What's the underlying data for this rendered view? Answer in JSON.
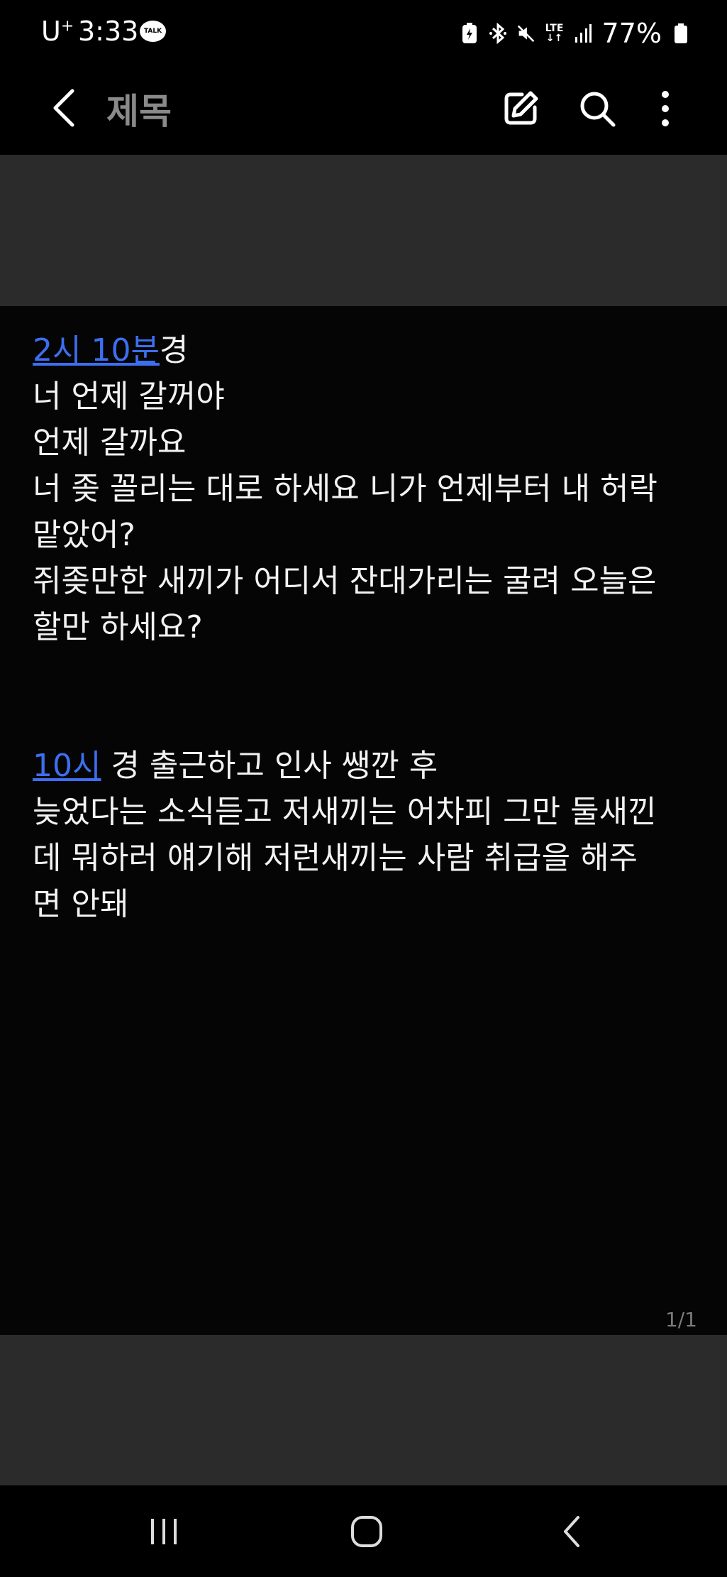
{
  "status_bar": {
    "carrier": "U",
    "carrier_sup": "+",
    "time": "3:33",
    "talk_badge": "TALK",
    "lte_label_top": "LTE",
    "lte_label_bottom": "↓↑",
    "battery": "77%",
    "icons": [
      "kakaotalk-notification-icon",
      "battery-saver-icon",
      "bluetooth-icon",
      "mute-icon",
      "lte-data-icon",
      "signal-icon",
      "battery-icon"
    ]
  },
  "app_bar": {
    "title": "제목",
    "icons": [
      "back-arrow-icon",
      "edit-icon",
      "search-icon",
      "more-vertical-icon"
    ]
  },
  "note": {
    "block1": {
      "link": "2시 10분",
      "link_suffix": "경",
      "lines": [
        "너 언제 갈꺼야",
        "언제 갈까요",
        "너 좆 꼴리는 대로 하세요 니가 언제부터 내 허락",
        "맡았어?",
        "쥐좆만한 새끼가 어디서 잔대가리는 굴려 오늘은",
        "할만 하세요?"
      ]
    },
    "block2": {
      "link": "10시",
      "link_suffix": " 경 출근하고 인사 쌩깐 후",
      "lines": [
        "늦었다는 소식듣고 저새끼는 어차피 그만 둘새낀",
        "데 뭐하러 얘기해 저런새끼는 사람 취급을 해주",
        "면 안돼"
      ]
    }
  },
  "page_indicator": "1/1",
  "nav_bar": {
    "icons": [
      "recent-apps-icon",
      "home-icon",
      "back-icon"
    ]
  }
}
